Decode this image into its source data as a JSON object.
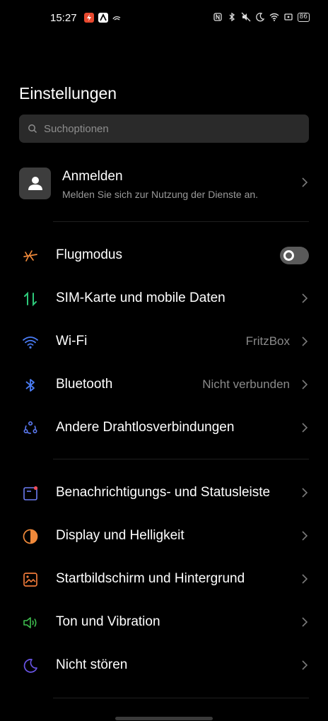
{
  "status_bar": {
    "time": "15:27",
    "battery": "86",
    "icons": [
      "nfc-icon",
      "bluetooth-icon",
      "mute-icon",
      "moon-icon",
      "wifi-icon",
      "cast-icon",
      "battery-icon"
    ],
    "app_icons": [
      "app-icon-red",
      "app-icon-white",
      "app-icon-bird"
    ]
  },
  "page": {
    "title": "Einstellungen"
  },
  "search": {
    "placeholder": "Suchoptionen"
  },
  "account": {
    "title": "Anmelden",
    "subtitle": "Melden Sie sich zur Nutzung der Dienste an."
  },
  "items": [
    {
      "label": "Flugmodus",
      "icon": "airplane-icon",
      "color": "#f0893a",
      "toggle": false
    },
    {
      "label": "SIM-Karte und mobile Daten",
      "icon": "mobile-data-icon",
      "color": "#2ec97a"
    },
    {
      "label": "Wi-Fi",
      "value": "FritzBox",
      "icon": "wifi-icon",
      "color": "#4a7cf5"
    },
    {
      "label": "Bluetooth",
      "value": "Nicht verbunden",
      "icon": "bluetooth-icon",
      "color": "#4a7cf5"
    },
    {
      "label": "Andere Drahtlosverbindungen",
      "icon": "connections-icon",
      "color": "#5b79f0"
    },
    {
      "label": "Benachrichtigungs- und Statusleiste",
      "icon": "notification-icon",
      "color": "#6c7cf3"
    },
    {
      "label": "Display und Helligkeit",
      "icon": "brightness-icon",
      "color": "#f0893a"
    },
    {
      "label": "Startbildschirm und Hintergrund",
      "icon": "wallpaper-icon",
      "color": "#f07a3a"
    },
    {
      "label": "Ton und Vibration",
      "icon": "sound-icon",
      "color": "#3fbf4f"
    },
    {
      "label": "Nicht stören",
      "icon": "do-not-disturb-icon",
      "color": "#6a55e8"
    }
  ]
}
